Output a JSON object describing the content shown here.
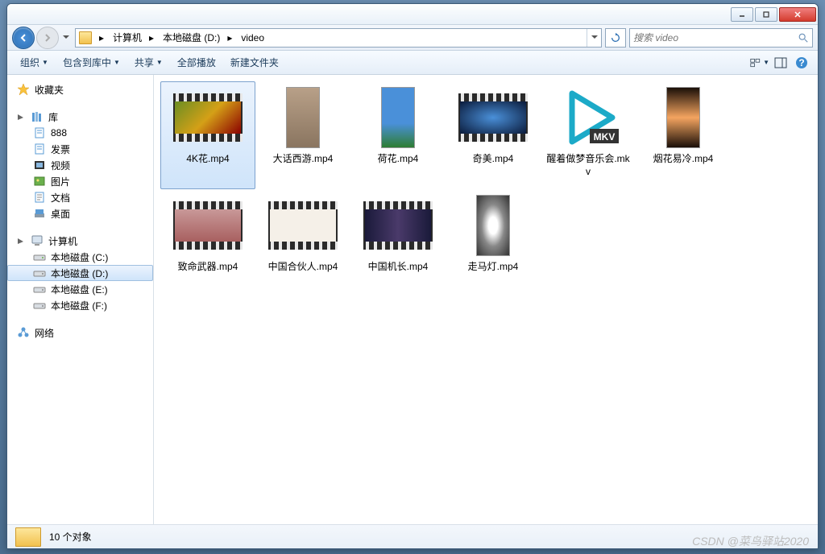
{
  "window": {
    "titlebar": {
      "min": "minimize",
      "max": "maximize",
      "close": "close"
    }
  },
  "nav": {
    "breadcrumbs": [
      "计算机",
      "本地磁盘 (D:)",
      "video"
    ],
    "search_placeholder": "搜索 video"
  },
  "toolbar": {
    "organize": "组织",
    "include": "包含到库中",
    "share": "共享",
    "playall": "全部播放",
    "newfolder": "新建文件夹"
  },
  "sidebar": {
    "favorites": "收藏夹",
    "library": "库",
    "lib_items": [
      "888",
      "发票",
      "视频",
      "图片",
      "文档",
      "桌面"
    ],
    "computer": "计算机",
    "drives": [
      "本地磁盘 (C:)",
      "本地磁盘 (D:)",
      "本地磁盘 (E:)",
      "本地磁盘 (F:)"
    ],
    "selected_drive": "本地磁盘 (D:)",
    "network": "网络"
  },
  "files": [
    {
      "name": "4K花.mp4",
      "type": "film",
      "bg": "linear-gradient(135deg,#6b8e23,#d4a017,#8b0000)",
      "selected": true
    },
    {
      "name": "大话西游.mp4",
      "type": "tall",
      "bg": "linear-gradient(#b8a088,#8a7560)"
    },
    {
      "name": "荷花.mp4",
      "type": "tall",
      "bg": "linear-gradient(#4a90d9 60%,#2e7d32)"
    },
    {
      "name": "奇美.mp4",
      "type": "film",
      "bg": "radial-gradient(#4a90d9,#0a1a3a)"
    },
    {
      "name": "醒着做梦音乐会.mkv",
      "type": "mkv",
      "bg": ""
    },
    {
      "name": "烟花易冷.mp4",
      "type": "tall",
      "bg": "linear-gradient(#1a0f08,#f4a460 50%,#1a0f08)"
    },
    {
      "name": "致命武器.mp4",
      "type": "film",
      "bg": "linear-gradient(#c89898,#a86060)"
    },
    {
      "name": "中国合伙人.mp4",
      "type": "film",
      "bg": "#f5f0e8"
    },
    {
      "name": "中国机长.mp4",
      "type": "film",
      "bg": "linear-gradient(90deg,#1a1a3a,#4a3a6a,#1a1a3a)"
    },
    {
      "name": "走马灯.mp4",
      "type": "tall",
      "bg": "radial-gradient(#fff 20%,#888 50%,#333)"
    }
  ],
  "statusbar": {
    "count": "10 个对象"
  },
  "watermark": "CSDN @菜鸟驿站2020"
}
